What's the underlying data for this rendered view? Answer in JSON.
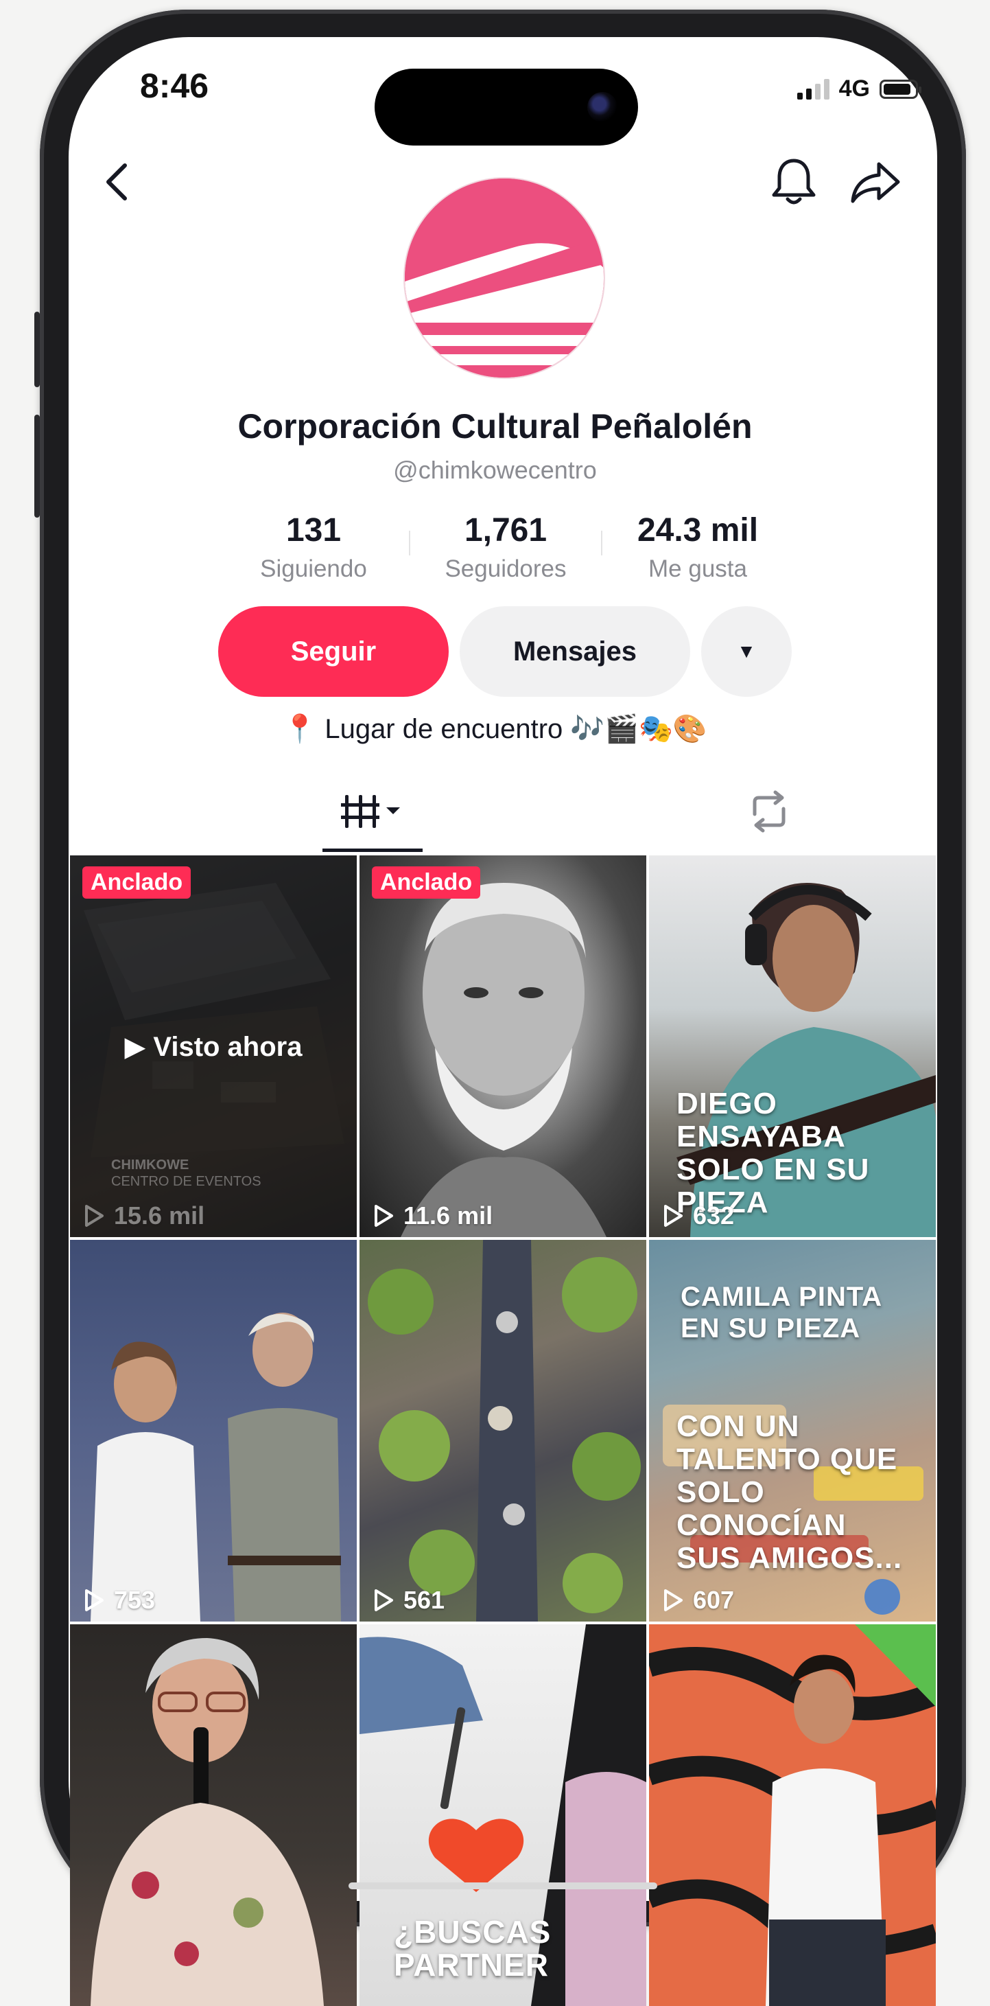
{
  "status": {
    "time": "8:46",
    "network": "4G"
  },
  "profile": {
    "name": "Corporación Cultural Peñalolén",
    "handle": "@chimkowecentro",
    "bio": "📍 Lugar de encuentro 🎶🎬🎭🎨",
    "brand_color": "#ec4f7f"
  },
  "stats": [
    {
      "value": "131",
      "label": "Siguiendo"
    },
    {
      "value": "1,761",
      "label": "Seguidores"
    },
    {
      "value": "24.3 mil",
      "label": "Me gusta"
    }
  ],
  "actions": {
    "follow": "Seguir",
    "message": "Mensajes",
    "more": "▼",
    "accent": "#fe2c55"
  },
  "icons": {
    "back": "back-arrow-icon",
    "bell": "bell-icon",
    "share": "share-icon",
    "grid": "grid-icon",
    "repost": "repost-icon"
  },
  "videos": [
    {
      "pinned": "Anclado",
      "views": "15.6 mil",
      "watched": "▶ Visto ahora",
      "watermark1": "CHIMKOWE",
      "watermark2": "CENTRO DE EVENTOS"
    },
    {
      "pinned": "Anclado",
      "views": "11.6 mil"
    },
    {
      "views": "632",
      "overlay": "DIEGO\nENSAYABA\nSOLO EN SU\nPIEZA"
    },
    {
      "views": "753"
    },
    {
      "views": "561"
    },
    {
      "views": "607",
      "overlay_top": "CAMILA PINTA\nEN SU PIEZA",
      "overlay": "CON UN\nTALENTO QUE\nSOLO\nCONOCÍAN\nSUS AMIGOS..."
    },
    {
      "views": ""
    },
    {
      "views": "",
      "overlay": "¿BUSCAS\nPARTNER"
    },
    {
      "views": ""
    }
  ]
}
